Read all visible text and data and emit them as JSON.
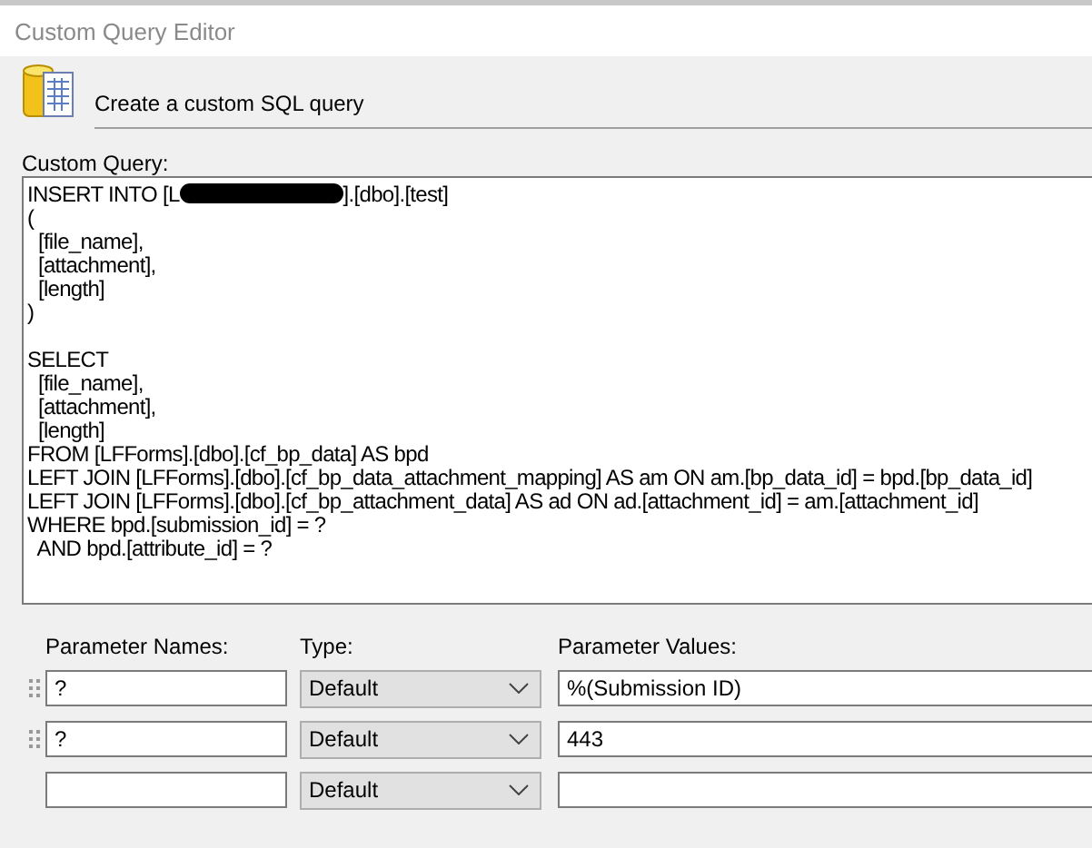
{
  "window": {
    "title": "Custom Query Editor"
  },
  "header": {
    "title": "Create a custom SQL query"
  },
  "query": {
    "label": "Custom Query:",
    "lines": [
      {
        "kind": "redacted",
        "before": "INSERT INTO [L",
        "after": "].[dbo].[test]"
      },
      {
        "kind": "plain",
        "text": "("
      },
      {
        "kind": "plain",
        "text": "  [file_name],"
      },
      {
        "kind": "plain",
        "text": "  [attachment],"
      },
      {
        "kind": "plain",
        "text": "  [length]"
      },
      {
        "kind": "plain",
        "text": ")"
      },
      {
        "kind": "blank"
      },
      {
        "kind": "plain",
        "text": "SELECT"
      },
      {
        "kind": "plain",
        "text": "  [file_name],"
      },
      {
        "kind": "plain",
        "text": "  [attachment],"
      },
      {
        "kind": "plain",
        "text": "  [length]"
      },
      {
        "kind": "plain",
        "text": "FROM [LFForms].[dbo].[cf_bp_data] AS bpd"
      },
      {
        "kind": "plain",
        "text": "LEFT JOIN [LFForms].[dbo].[cf_bp_data_attachment_mapping] AS am ON am.[bp_data_id] = bpd.[bp_data_id]"
      },
      {
        "kind": "plain",
        "text": "LEFT JOIN [LFForms].[dbo].[cf_bp_attachment_data] AS ad ON ad.[attachment_id] = am.[attachment_id]"
      },
      {
        "kind": "plain",
        "text": "WHERE bpd.[submission_id] = ?"
      },
      {
        "kind": "plain",
        "text": "  AND bpd.[attribute_id] = ?"
      }
    ]
  },
  "parameters": {
    "columns": [
      "Parameter Names:",
      "Type:",
      "Parameter Values:"
    ],
    "rows": [
      {
        "name": "?",
        "type": "Default",
        "value": "%(Submission ID)",
        "draggable": true
      },
      {
        "name": "?",
        "type": "Default",
        "value": "443",
        "draggable": true
      },
      {
        "type": "Default",
        "draggable": false
      }
    ]
  }
}
